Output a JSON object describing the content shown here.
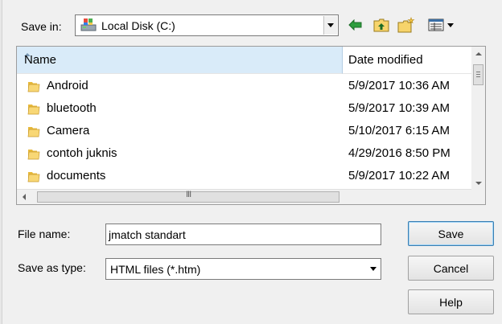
{
  "save_in": {
    "label": "Save in:",
    "value": "Local Disk (C:)",
    "icon": "local-disk-icon"
  },
  "toolbar": {
    "icons": [
      "back-arrow-icon",
      "up-one-level-icon",
      "new-folder-icon",
      "view-menu-icon"
    ],
    "colors": {
      "back_arrow": "#1b7b2a",
      "folder_yellow": "#f2c94c"
    }
  },
  "file_list": {
    "columns": [
      "Name",
      "Date modified"
    ],
    "rows": [
      {
        "name": "Android",
        "date": "5/9/2017 10:36 AM"
      },
      {
        "name": "bluetooth",
        "date": "5/9/2017 10:39 AM"
      },
      {
        "name": "Camera",
        "date": "5/10/2017 6:15 AM"
      },
      {
        "name": "contoh juknis",
        "date": "4/29/2016 8:50 PM"
      },
      {
        "name": "documents",
        "date": "5/9/2017 10:22 AM"
      }
    ],
    "header_highlight_color": "#d9ebf9",
    "hscroll_grip": "III"
  },
  "file_name": {
    "label": "File name:",
    "value": "jmatch standart"
  },
  "save_as_type": {
    "label": "Save as type:",
    "value": "HTML files (*.htm)"
  },
  "buttons": {
    "save": "Save",
    "cancel": "Cancel",
    "help": "Help"
  }
}
